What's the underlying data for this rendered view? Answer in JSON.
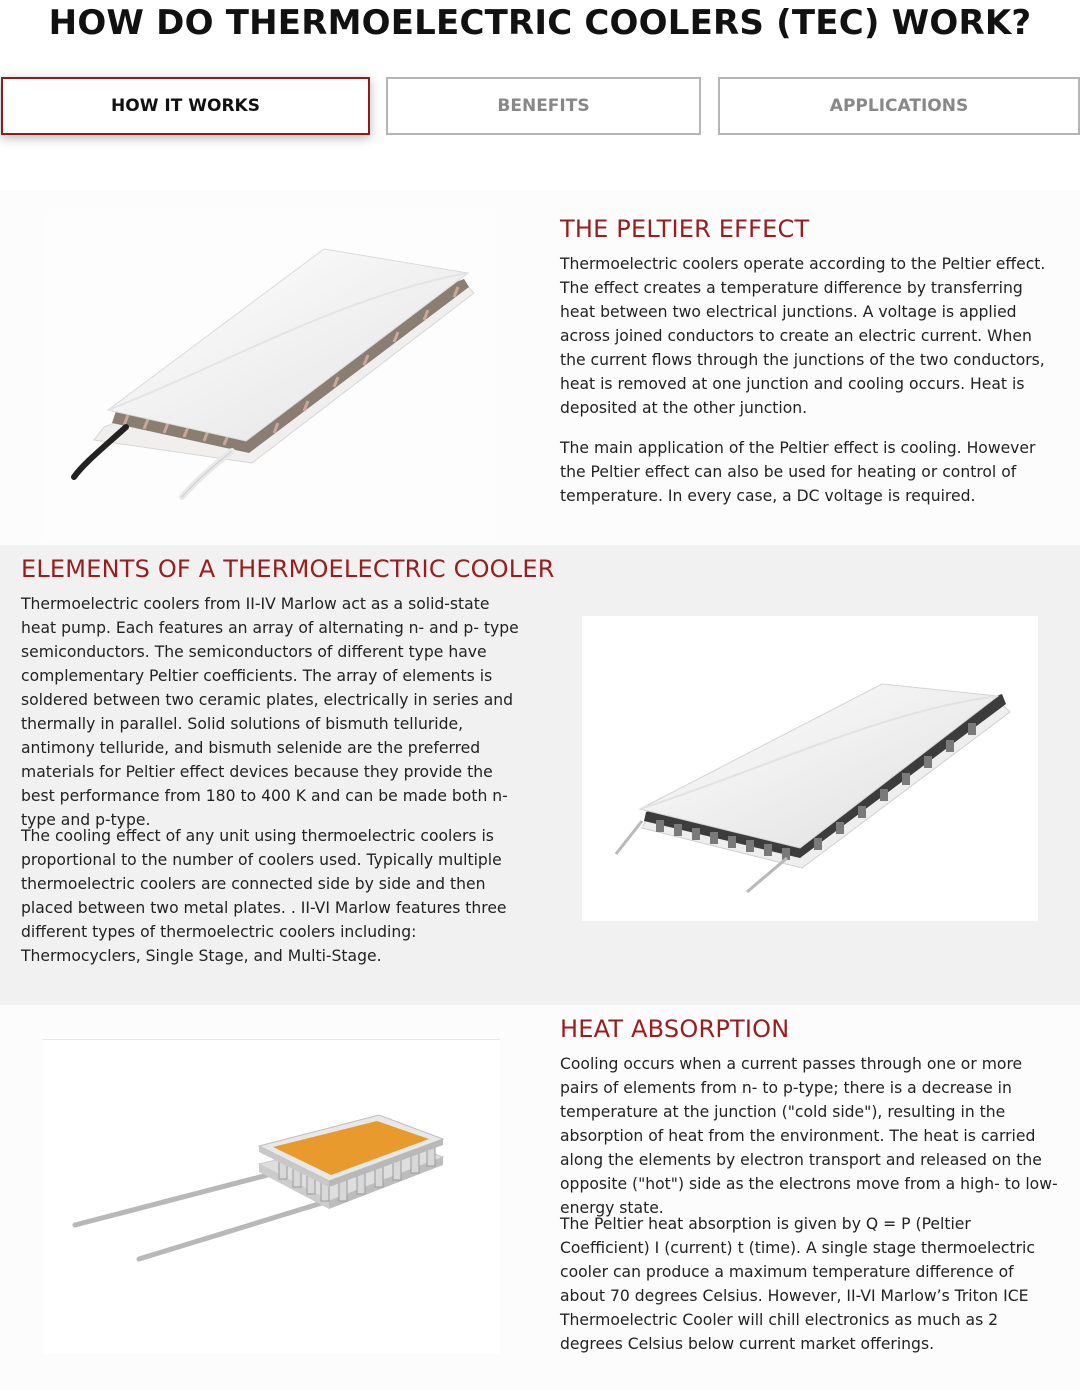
{
  "page": {
    "title": "HOW DO THERMOELECTRIC COOLERS (TEC) WORK?"
  },
  "tabs": [
    {
      "label": "HOW IT WORKS",
      "active": true
    },
    {
      "label": "BENEFITS",
      "active": false
    },
    {
      "label": "APPLICATIONS",
      "active": false
    }
  ],
  "sections": {
    "peltier": {
      "heading": "THE PELTIER EFFECT",
      "paragraphs": [
        "Thermoelectric coolers operate according to the Peltier effect. The effect creates a temperature difference by transferring heat between two electrical junctions. A voltage is applied across joined conductors to create an electric current. When the current flows through the junctions of the two conductors, heat is removed at one junction and cooling occurs. Heat is deposited at the other junction.",
        "The main application of the Peltier effect is cooling. However the Peltier effect can also be used for heating or control of temperature. In every case, a DC voltage is required."
      ]
    },
    "elements": {
      "heading": "ELEMENTS OF A THERMOELECTRIC COOLER",
      "paragraphs": [
        "Thermoelectric coolers from II-IV Marlow act as a solid-state heat pump. Each features an array of alternating n- and p- type semiconductors. The semiconductors of different type have complementary Peltier coefficients. The array of elements is soldered between two ceramic plates, electrically in series and thermally in parallel. Solid solutions of bismuth telluride, antimony telluride, and bismuth selenide are the preferred materials for Peltier effect devices because they provide the best performance from 180 to 400 K and can be made both n-type and p-type.",
        "The cooling effect of any unit using thermoelectric coolers is proportional to the number of coolers used. Typically multiple thermoelectric coolers are connected side by side and then placed between two metal plates. . II-VI Marlow features three different types of thermoelectric coolers including: Thermocyclers, Single Stage, and Multi-Stage."
      ]
    },
    "heat": {
      "heading": "HEAT ABSORPTION",
      "paragraphs": [
        "Cooling occurs when a current passes through one or more pairs of elements from n- to p-type; there is a decrease in temperature at the junction (\"cold side\"), resulting in the absorption of heat from the environment. The heat is carried along the elements by electron transport and released on the opposite (\"hot\") side as the electrons move from a high- to low-energy state.",
        "The Peltier heat absorption is given by Q = P (Peltier Coefficient) I (current) t (time). A single stage thermoelectric cooler can produce a maximum temperature difference of about 70 degrees Celsius. However, II-VI Marlow’s Triton ICE Thermoelectric Cooler will chill electronics as much as 2 degrees Celsius below current market offerings."
      ]
    }
  },
  "colors": {
    "accent": "#9b1c1c",
    "tab_border": "#b5b5b5",
    "band_bg": "#f1f1f1"
  }
}
